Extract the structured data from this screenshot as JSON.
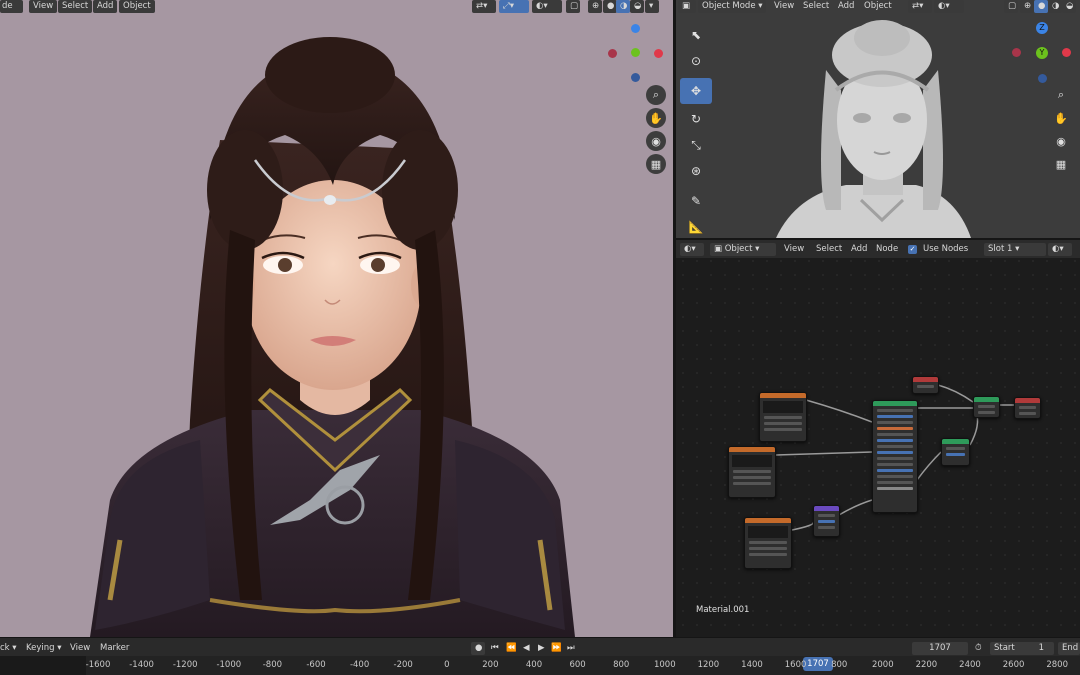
{
  "left_viewport": {
    "menu": [
      "View",
      "Select",
      "Add",
      "Object"
    ],
    "mode_partial": "de"
  },
  "right_viewport": {
    "mode": "Object Mode",
    "menu": [
      "View",
      "Select",
      "Add",
      "Object"
    ],
    "gizmo_axes": [
      "Z",
      "Y"
    ]
  },
  "node_editor": {
    "type_label": "Object",
    "menu": [
      "View",
      "Select",
      "Add",
      "Node"
    ],
    "use_nodes_label": "Use Nodes",
    "use_nodes_checked": true,
    "slot": "Slot 1",
    "material_name": "Material.001"
  },
  "timeline": {
    "playback_partial": "ck",
    "keying": "Keying",
    "menu": [
      "View",
      "Marker"
    ],
    "current_frame": "1707",
    "start_label": "Start",
    "start_value": "1",
    "end_label": "End",
    "ruler": [
      "-1600",
      "-1400",
      "-1200",
      "-1000",
      "-800",
      "-600",
      "-400",
      "-200",
      "0",
      "200",
      "400",
      "600",
      "800",
      "1000",
      "1200",
      "1400",
      "1600",
      "800",
      "2000",
      "2200",
      "2400",
      "2600",
      "2800"
    ],
    "playhead_label": "1707"
  },
  "colors": {
    "left_bg": "#a697a2",
    "right_bg": "#3c3c3c",
    "node_bg": "#1c1c1c",
    "accent_blue": "#4772b3",
    "axis_red": "#e0394a",
    "axis_green": "#6cc21d",
    "axis_blue": "#3b84e6"
  },
  "icons": [
    "cursor-icon",
    "3d-cursor-icon",
    "move-icon",
    "rotate-icon",
    "scale-icon",
    "transform-icon",
    "annotate-icon",
    "measure-icon",
    "zoom-icon",
    "pan-hand-icon",
    "camera-icon",
    "grid-icon"
  ]
}
